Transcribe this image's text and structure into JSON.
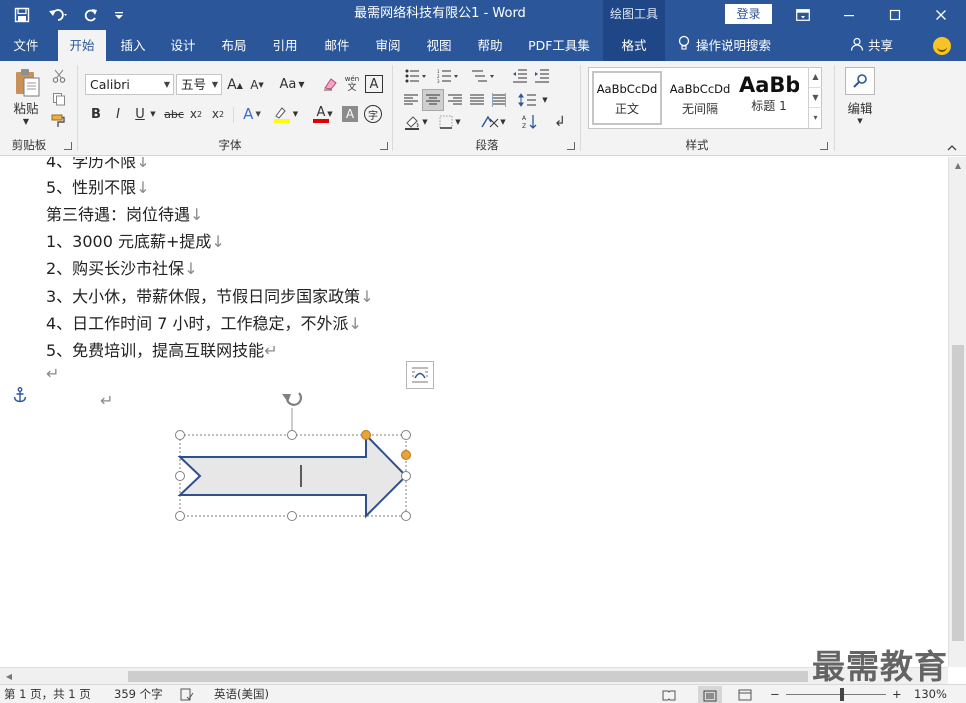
{
  "titlebar": {
    "title": "最需网络科技有限公1  -  Word",
    "tools_label": "绘图工具",
    "login": "登录"
  },
  "tabs": [
    {
      "label": "文件"
    },
    {
      "label": "开始"
    },
    {
      "label": "插入"
    },
    {
      "label": "设计"
    },
    {
      "label": "布局"
    },
    {
      "label": "引用"
    },
    {
      "label": "邮件"
    },
    {
      "label": "审阅"
    },
    {
      "label": "视图"
    },
    {
      "label": "帮助"
    },
    {
      "label": "PDF工具集"
    },
    {
      "label": "格式"
    }
  ],
  "tell_me": "操作说明搜索",
  "share": "共享",
  "ribbon": {
    "clipboard": {
      "paste": "粘贴",
      "label": "剪贴板"
    },
    "font": {
      "name": "Calibri",
      "size": "五号",
      "label": "字体",
      "wen": "文",
      "aa": "Aa"
    },
    "paragraph": {
      "label": "段落"
    },
    "styles": {
      "label": "样式",
      "items": [
        {
          "preview": "AaBbCcDd",
          "name": "正文"
        },
        {
          "preview": "AaBbCcDd",
          "name": "无间隔"
        },
        {
          "preview": "AaBb",
          "name": "标题 1"
        }
      ]
    },
    "editing": {
      "label": "编辑"
    }
  },
  "document": {
    "lines": [
      {
        "text": "4、学历不限",
        "mark": "↓"
      },
      {
        "text": "5、性别不限",
        "mark": "↓"
      },
      {
        "text": "第三待遇：岗位待遇",
        "mark": "↓"
      },
      {
        "text": "1、3000 元底薪+提成",
        "mark": "↓"
      },
      {
        "text": "2、购买长沙市社保",
        "mark": "↓"
      },
      {
        "text": "3、大小休，带薪休假，节假日同步国家政策",
        "mark": "↓"
      },
      {
        "text": "4、日工作时间 7 小时，工作稳定，不外派",
        "mark": "↓"
      },
      {
        "text": "5、免费培训，提高互联网技能",
        "mark": "↵"
      },
      {
        "text": "",
        "mark": "↵"
      }
    ],
    "anchor_mark": "↵"
  },
  "status": {
    "page": "第 1 页，共 1 页",
    "words": "359 个字",
    "language": "英语(美国)",
    "zoom": "130%",
    "zoom_minus": "−",
    "zoom_plus": "+"
  },
  "watermark": "最需教育",
  "colors": {
    "word_blue": "#2b579a",
    "tool_tab": "#1f4788",
    "shape_fill": "#e7e7e7",
    "shape_stroke": "#2f4f8f",
    "adjust_handle": "#e8a23a"
  }
}
